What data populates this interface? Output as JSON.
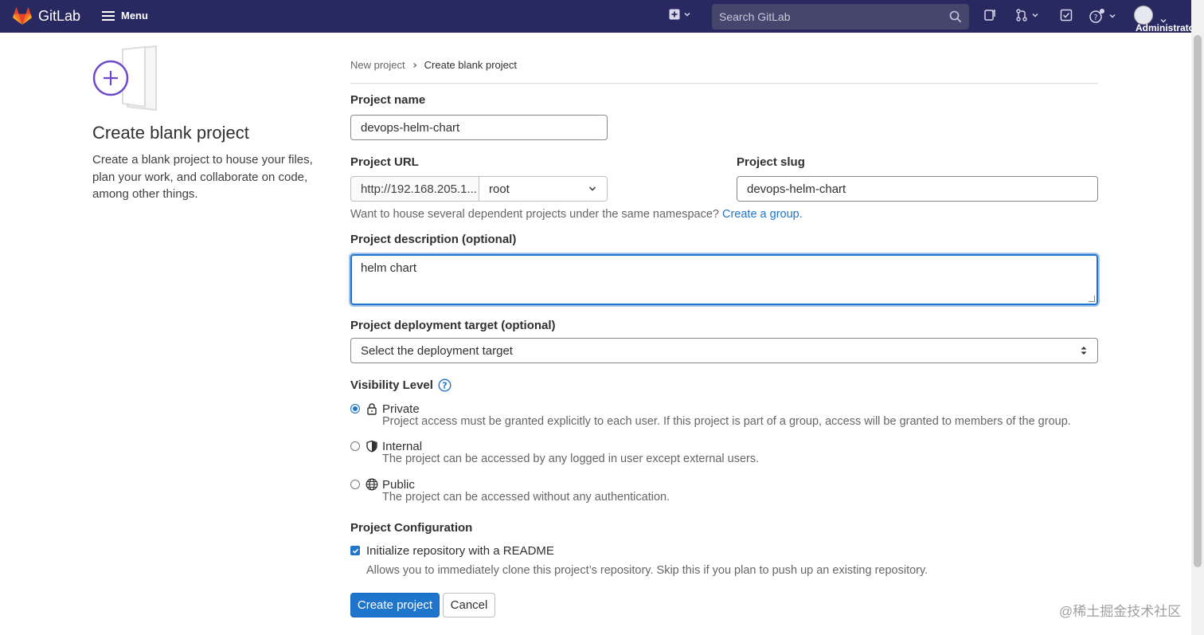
{
  "nav": {
    "app_name": "GitLab",
    "menu_label": "Menu",
    "search_placeholder": "Search GitLab",
    "user_label": "Administrator"
  },
  "left": {
    "title": "Create blank project",
    "description": "Create a blank project to house your files, plan your work, and collaborate on code, among other things."
  },
  "breadcrumb": {
    "parent": "New project",
    "current": "Create blank project"
  },
  "form": {
    "project_name_label": "Project name",
    "project_name_value": "devops-helm-chart",
    "project_url_label": "Project URL",
    "project_url_prefix": "http://192.168.205.1...",
    "namespace_value": "root",
    "project_slug_label": "Project slug",
    "project_slug_value": "devops-helm-chart",
    "namespace_help": "Want to house several dependent projects under the same namespace?",
    "namespace_help_link": "Create a group.",
    "description_label": "Project description (optional)",
    "description_value": "helm chart",
    "deployment_label": "Project deployment target (optional)",
    "deployment_placeholder": "Select the deployment target",
    "visibility_label": "Visibility Level",
    "visibility_options": [
      {
        "title": "Private",
        "desc": "Project access must be granted explicitly to each user. If this project is part of a group, access will be granted to members of the group.",
        "selected": true
      },
      {
        "title": "Internal",
        "desc": "The project can be accessed by any logged in user except external users.",
        "selected": false
      },
      {
        "title": "Public",
        "desc": "The project can be accessed without any authentication.",
        "selected": false
      }
    ],
    "config_label": "Project Configuration",
    "readme_label": "Initialize repository with a README",
    "readme_help": "Allows you to immediately clone this project’s repository. Skip this if you plan to push up an existing repository.",
    "readme_checked": true,
    "create_button": "Create project",
    "cancel_button": "Cancel"
  },
  "watermark": "@稀土掘金技术社区",
  "colors": {
    "navbar": "#292961",
    "primary": "#1f75cb",
    "logo_orange": "#e24329"
  }
}
